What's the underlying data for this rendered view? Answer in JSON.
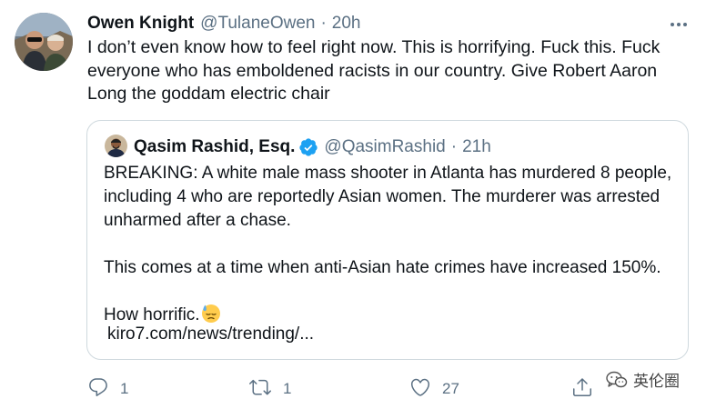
{
  "tweet": {
    "author_name": "Owen Knight",
    "author_handle": "@TulaneOwen",
    "separator": "·",
    "time": "20h",
    "text": "I don’t even know how to feel right now. This is horrifying. Fuck this. Fuck everyone who has emboldened racists in our country. Give Robert Aaron Long the goddam electric chair"
  },
  "quoted_tweet": {
    "author_name": "Qasim Rashid, Esq.",
    "author_handle": "@QasimRashid",
    "separator": "·",
    "time": "21h",
    "paragraph_1": "BREAKING: A white male mass shooter in Atlanta has murdered 8 people, including 4 who are reportedly Asian women. The murderer was arrested unharmed after a chase.",
    "paragraph_2": "This comes at a time when anti-Asian hate crimes have increased 150%.",
    "paragraph_3": "How horrific.",
    "link": "kiro7.com/news/trending/..."
  },
  "actions": {
    "reply_count": "1",
    "retweet_count": "1",
    "like_count": "27"
  },
  "watermark": {
    "text": "英伦圈"
  },
  "icons": {
    "more": "more-horizontal-icon",
    "verified": "verified-badge-icon",
    "reply": "reply-icon",
    "retweet": "retweet-icon",
    "like": "heart-icon",
    "share": "share-icon",
    "emoji": "downcast-face-with-sweat-emoji",
    "watermark": "wechat-icon"
  },
  "colors": {
    "text_primary": "#0f1419",
    "text_secondary": "#5b7083",
    "border": "#cfd9de",
    "verified": "#1da1f2"
  }
}
